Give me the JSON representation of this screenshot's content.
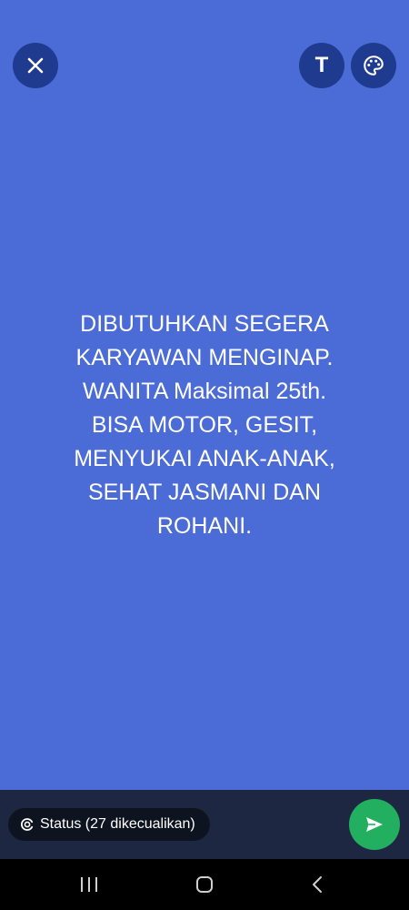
{
  "toolbar": {
    "close_icon": "close-icon",
    "text_label": "T",
    "palette_icon": "palette-icon"
  },
  "status": {
    "background_color": "#4b6bd6",
    "lines": [
      "DIBUTUHKAN SEGERA",
      "KARYAWAN MENGINAP.",
      "WANITA Maksimal 25th.",
      "BISA MOTOR, GESIT,",
      "MENYUKAI ANAK-ANAK,",
      "SEHAT JASMANI DAN",
      "ROHANI."
    ]
  },
  "footer": {
    "audience_label": "Status (27 dikecualikan)",
    "audience_icon": "status-ring-icon",
    "send_icon": "send-icon",
    "send_color": "#22b060"
  },
  "navigation": {
    "recents_icon": "recents-icon",
    "home_icon": "home-icon",
    "back_icon": "back-icon"
  }
}
